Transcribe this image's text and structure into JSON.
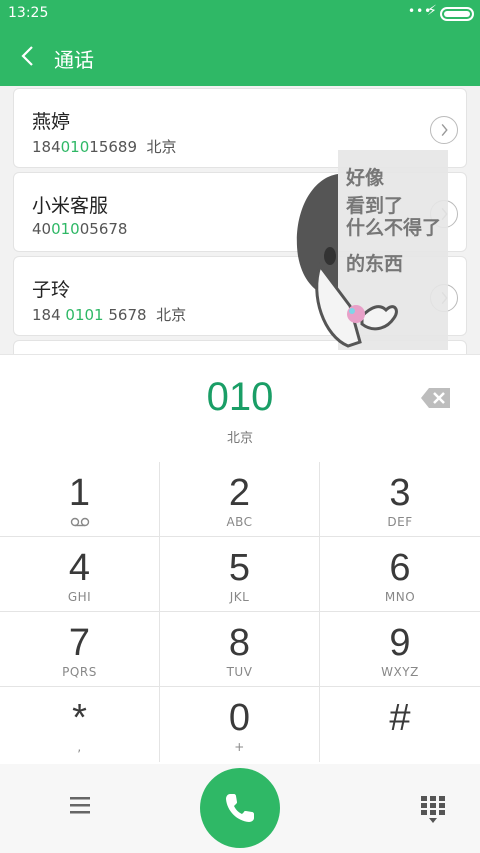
{
  "status_bar": {
    "time": "13:25",
    "dots": "•••"
  },
  "app_bar": {
    "title": "通话"
  },
  "contacts": [
    {
      "name": "燕婷",
      "number_pre": "184",
      "number_match": "010",
      "number_post": "15689",
      "location": "北京"
    },
    {
      "name": "小米客服",
      "number_pre": "40",
      "number_match": "010",
      "number_post": "05678",
      "location": ""
    },
    {
      "name": "子玲",
      "number_pre": "184 ",
      "number_match": "0101",
      "number_post": " 5678",
      "location": "北京"
    }
  ],
  "sticker": {
    "line1": "好像",
    "line2": "看到了",
    "line3": "什么不得了",
    "line4": "的东西"
  },
  "dial": {
    "digits": "010",
    "location": "北京"
  },
  "keypad": [
    {
      "digit": "1",
      "letters": ""
    },
    {
      "digit": "2",
      "letters": "ABC"
    },
    {
      "digit": "3",
      "letters": "DEF"
    },
    {
      "digit": "4",
      "letters": "GHI"
    },
    {
      "digit": "5",
      "letters": "JKL"
    },
    {
      "digit": "6",
      "letters": "MNO"
    },
    {
      "digit": "7",
      "letters": "PQRS"
    },
    {
      "digit": "8",
      "letters": "TUV"
    },
    {
      "digit": "9",
      "letters": "WXYZ"
    },
    {
      "digit": "*",
      "letters": ","
    },
    {
      "digit": "0",
      "letters": "+"
    },
    {
      "digit": "#",
      "letters": ""
    }
  ],
  "colors": {
    "accent": "#2fb866",
    "digits": "#1a9e66"
  }
}
